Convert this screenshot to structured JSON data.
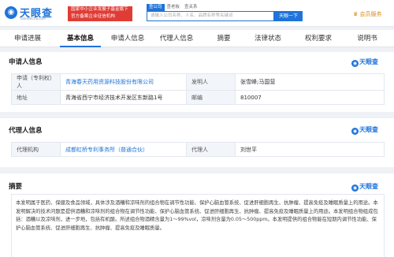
{
  "header": {
    "logo_text": "天眼查",
    "logo_url": "TianYanCha.com",
    "banner_line1": "国家中小企业发展子基金旗下",
    "banner_line2": "官方备案企业征信机构",
    "search_tabs": [
      "查公司",
      "查老板",
      "查关系"
    ],
    "search_placeholder": "请输入公司名称、人名、品牌名称等关键词",
    "search_button": "天眼一下",
    "vip_label": "会员服务"
  },
  "tabs": [
    "申请进展",
    "基本信息",
    "申请人信息",
    "代理人信息",
    "摘要",
    "法律状态",
    "权利要求",
    "说明书"
  ],
  "watermark": "天眼查",
  "applicant_section": {
    "title": "申请人信息",
    "rows": [
      {
        "label1": "申请（专利权）人",
        "value1": "青海春天药用资源科技股份有限公司",
        "label2": "发明人",
        "value2": "张雪峰;马国营"
      },
      {
        "label1": "地址",
        "value1": "青海省西宁市经济技术开发区东新路1号",
        "label2": "邮编",
        "value2": "810007"
      }
    ]
  },
  "agent_section": {
    "title": "代理人信息",
    "row": {
      "label1": "代理机构",
      "value1": "成都虹桥专利事务所（普通合伙）",
      "label2": "代理人",
      "value2": "刘世平"
    }
  },
  "abstract_section": {
    "title": "摘要",
    "text": "本发明属于医药、保健及食品领域，具体涉及酒糟和凉味剂的组合物在调节性功能、保护心脑血管系统、促进肝细胞再生、抗肿瘤、提高免疫及睡眠质量上的用途。本发明解决的技术问题是提供酒糟和凉味剂的组合物在调节性功能、保护心脑血管系统、促进肝细胞再生、抗肿瘤、提高免疫及睡眠质量上的用途。本发明组合物组成包括：酒糟以及凉味剂，进一步地，包括有机酸。所述组合物酒精含量为1～99%vol，凉味剂含量为0.05～500ppm。本发明提供的组合物能在短期内调节性功能、保护心脑血管系统、促进肝细胞再生、抗肿瘤、提高免疫及睡眠质量。"
  }
}
